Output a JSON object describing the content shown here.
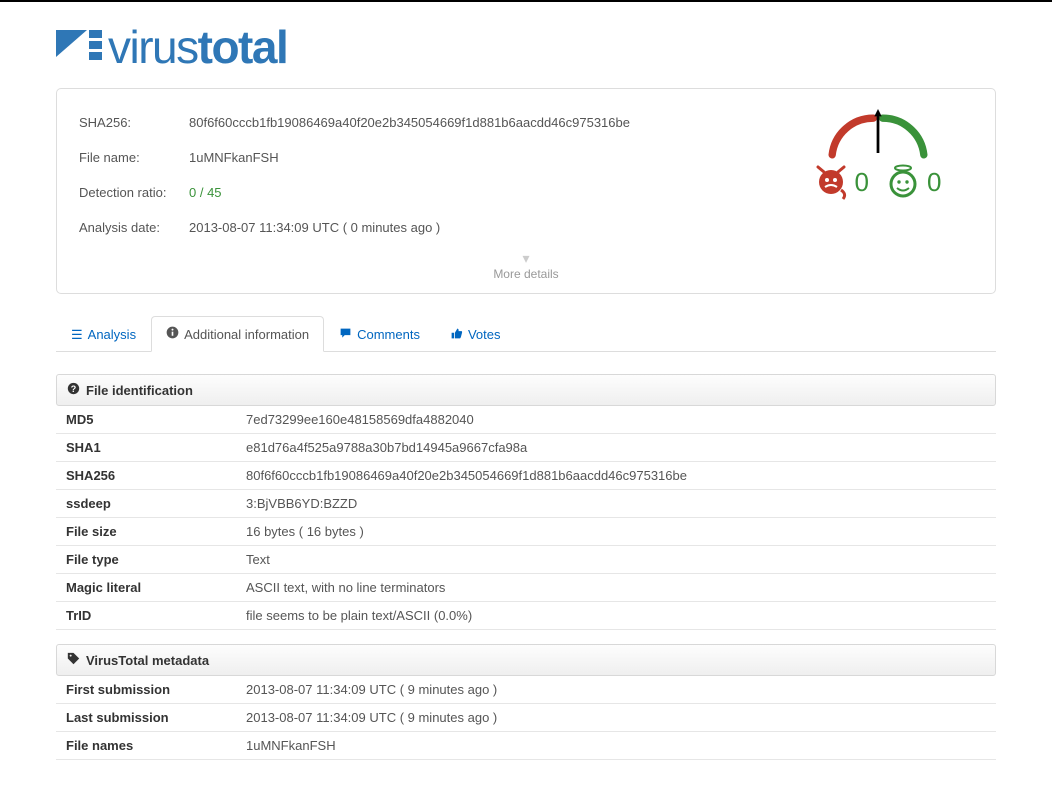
{
  "logo": {
    "virus": "virus",
    "total": "total"
  },
  "summary": {
    "fields": {
      "sha256_label": "SHA256:",
      "sha256": "80f6f60cccb1fb19086469a40f20e2b345054669f1d881b6aacdd46c975316be",
      "filename_label": "File name:",
      "filename": "1uMNFkanFSH",
      "ratio_label": "Detection ratio:",
      "ratio": "0 / 45",
      "date_label": "Analysis date:",
      "date": "2013-08-07 11:34:09 UTC ( 0 minutes ago )"
    },
    "votes": {
      "malicious": "0",
      "harmless": "0"
    },
    "more_details": "More details"
  },
  "tabs": {
    "analysis": "Analysis",
    "additional": "Additional information",
    "comments": "Comments",
    "votes": "Votes"
  },
  "sections": {
    "file_ident": "File identification",
    "vt_meta": "VirusTotal metadata"
  },
  "file_ident": {
    "md5_k": "MD5",
    "md5": "7ed73299ee160e48158569dfa4882040",
    "sha1_k": "SHA1",
    "sha1": "e81d76a4f525a9788a30b7bd14945a9667cfa98a",
    "sha256_k": "SHA256",
    "sha256": "80f6f60cccb1fb19086469a40f20e2b345054669f1d881b6aacdd46c975316be",
    "ssdeep_k": "ssdeep",
    "ssdeep": "3:BjVBB6YD:BZZD",
    "size_k": "File size",
    "size": "16 bytes ( 16 bytes )",
    "type_k": "File type",
    "type": "Text",
    "magic_k": "Magic literal",
    "magic": "ASCII text, with no line terminators",
    "trid_k": "TrID",
    "trid": "file seems to be plain text/ASCII (0.0%)"
  },
  "vt_meta": {
    "first_k": "First submission",
    "first": "2013-08-07 11:34:09 UTC ( 9 minutes ago )",
    "last_k": "Last submission",
    "last": "2013-08-07 11:34:09 UTC ( 9 minutes ago )",
    "names_k": "File names",
    "names": "1uMNFkanFSH"
  }
}
